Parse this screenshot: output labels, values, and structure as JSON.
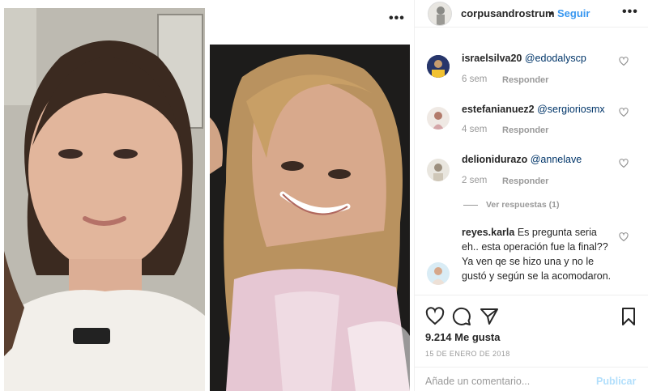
{
  "header": {
    "username": "corpusandrostrum",
    "separator": "•",
    "follow_label": "Seguir",
    "more_icon": "more-horizontal-icon"
  },
  "media": {
    "more_icon": "more-horizontal-icon"
  },
  "comments": [
    {
      "username": "israelsilva20",
      "mention": "@edodalyscp",
      "text": "",
      "time": "6 sem",
      "reply_label": "Responder"
    },
    {
      "username": "estefanianuez2",
      "mention": "@sergioriosmx",
      "text": "",
      "time": "4 sem",
      "reply_label": "Responder"
    },
    {
      "username": "delionidurazo",
      "mention": "@annelave",
      "text": "",
      "time": "2 sem",
      "reply_label": "Responder"
    },
    {
      "username": "reyes.karla",
      "mention": "",
      "text": "Es pregunta seria eh.. esta operación fue la final?? Ya ven qe se hizo una y no le gustó y según se la acomodaron."
    }
  ],
  "view_replies_label": "Ver respuestas (1)",
  "actions": {
    "like_icon": "heart-icon",
    "comment_icon": "comment-icon",
    "share_icon": "share-icon",
    "save_icon": "bookmark-icon",
    "likes_text": "9.214 Me gusta",
    "date_text": "15 DE ENERO DE 2018"
  },
  "add_comment": {
    "placeholder": "Añade un comentario...",
    "publish_label": "Publicar"
  },
  "colors": {
    "accent": "#3897f0",
    "publish_disabled": "#b2dffc",
    "muted": "#999999",
    "text": "#262626",
    "border": "#efefef"
  }
}
